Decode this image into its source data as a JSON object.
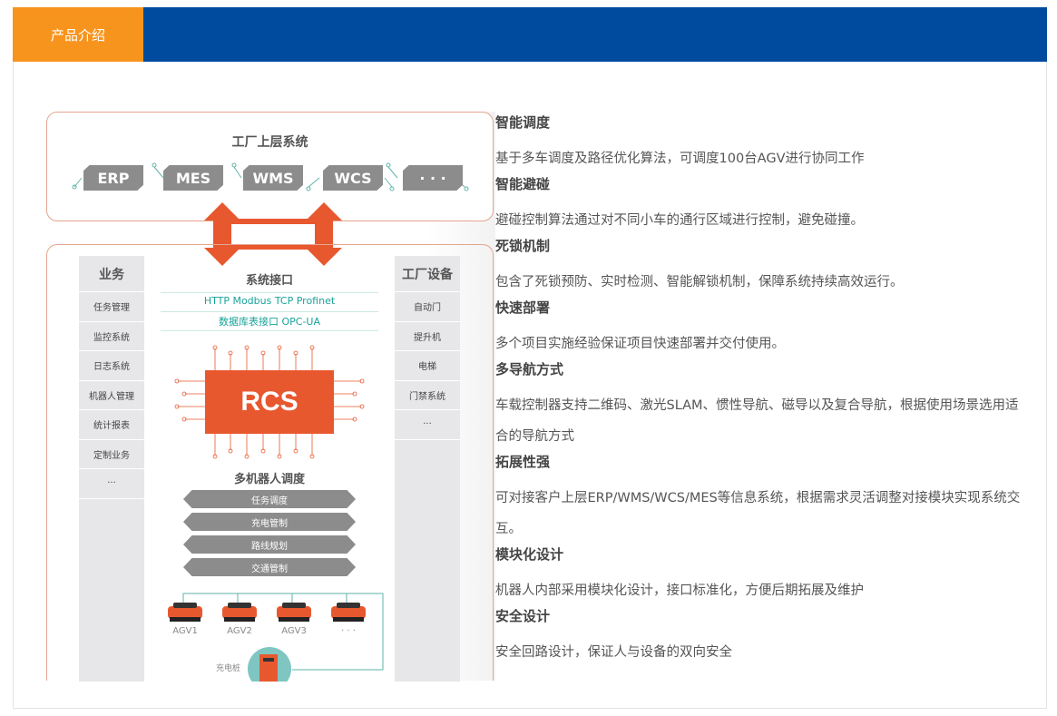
{
  "header": {
    "tab_label": "产品介绍"
  },
  "colors": {
    "header_blue": "#004b9e",
    "tab_orange": "#f7941d",
    "rcs_orange": "#e8582f",
    "arrow_orange": "#e8582f",
    "teal": "#1aa39a"
  },
  "diagram": {
    "top_title": "工厂上层系统",
    "systems": [
      "ERP",
      "MES",
      "WMS",
      "WCS",
      "· · ·"
    ],
    "business": {
      "title": "业务",
      "items": [
        "任务管理",
        "监控系统",
        "日志系统",
        "机器人管理",
        "统计报表",
        "定制业务",
        "···"
      ]
    },
    "equipment": {
      "title": "工厂设备",
      "items": [
        "自动门",
        "提升机",
        "电梯",
        "门禁系统",
        "···"
      ]
    },
    "interface_title": "系统接口",
    "protocols_line1": "HTTP    Modbus TCP    Profinet",
    "protocols_line2": "数据库表接口    OPC-UA",
    "rcs_label": "RCS",
    "scheduling_title": "多机器人调度",
    "scheduling_items": [
      "任务调度",
      "充电管制",
      "路线规划",
      "交通管制"
    ],
    "agvs": [
      "AGV1",
      "AGV2",
      "AGV3",
      "· · ·"
    ],
    "charger_label": "充电桩"
  },
  "features": [
    {
      "title": "智能调度",
      "desc": "基于多车调度及路径优化算法，可调度100台AGV进行协同工作"
    },
    {
      "title": "智能避碰",
      "desc": "避碰控制算法通过对不同小车的通行区域进行控制，避免碰撞。"
    },
    {
      "title": "死锁机制",
      "desc": "包含了死锁预防、实时检测、智能解锁机制，保障系统持续高效运行。"
    },
    {
      "title": "快速部署",
      "desc": "多个项目实施经验保证项目快速部署并交付使用。"
    },
    {
      "title": "多导航方式",
      "desc": "车载控制器支持二维码、激光SLAM、惯性导航、磁导以及复合导航，根据使用场景选用适合的导航方式"
    },
    {
      "title": "拓展性强",
      "desc": "可对接客户上层ERP/WMS/WCS/MES等信息系统，根据需求灵活调整对接模块实现系统交互。"
    },
    {
      "title": "模块化设计",
      "desc": "机器人内部采用模块化设计，接口标准化，方便后期拓展及维护"
    },
    {
      "title": "安全设计",
      "desc": "安全回路设计，保证人与设备的双向安全"
    }
  ]
}
